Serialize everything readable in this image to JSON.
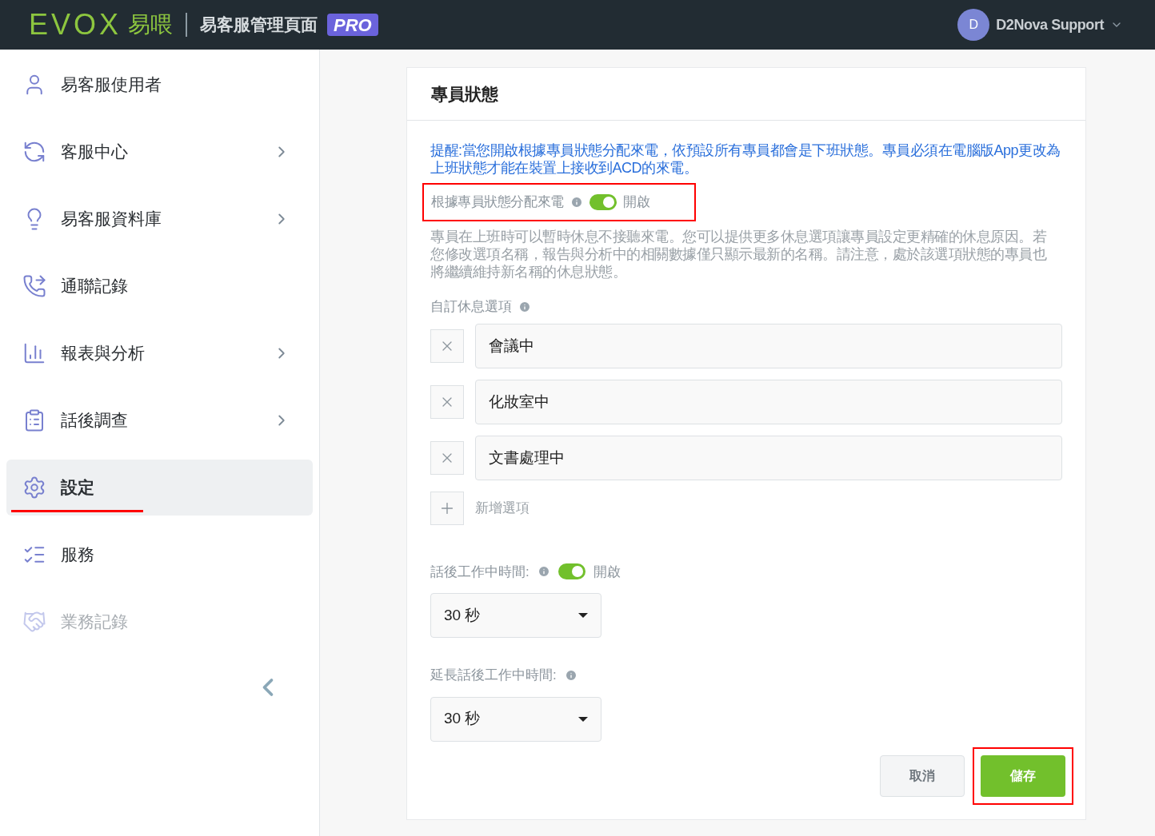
{
  "header": {
    "logo_latin": "EVOX",
    "logo_cjk": "易喂",
    "title": "易客服管理頁面",
    "badge": "PRO",
    "user": {
      "initial": "D",
      "name": "D2Nova Support"
    }
  },
  "sidebar": {
    "items": [
      {
        "label": "易客服使用者",
        "chevron": false,
        "selected": false,
        "disabled": false,
        "highlighted": false
      },
      {
        "label": "客服中心",
        "chevron": true,
        "selected": false,
        "disabled": false,
        "highlighted": false
      },
      {
        "label": "易客服資料庫",
        "chevron": true,
        "selected": false,
        "disabled": false,
        "highlighted": false
      },
      {
        "label": "通聯記錄",
        "chevron": false,
        "selected": false,
        "disabled": false,
        "highlighted": false
      },
      {
        "label": "報表與分析",
        "chevron": true,
        "selected": false,
        "disabled": false,
        "highlighted": false
      },
      {
        "label": "話後調查",
        "chevron": true,
        "selected": false,
        "disabled": false,
        "highlighted": false
      },
      {
        "label": "設定",
        "chevron": false,
        "selected": true,
        "disabled": false,
        "highlighted": true
      },
      {
        "label": "服務",
        "chevron": false,
        "selected": false,
        "disabled": false,
        "highlighted": false
      },
      {
        "label": "業務記錄",
        "chevron": false,
        "selected": false,
        "disabled": true,
        "highlighted": false
      }
    ]
  },
  "card": {
    "title": "專員狀態",
    "notice": "提醒:當您開啟根據專員狀態分配來電，依預設所有專員都會是下班狀態。專員必須在電腦版App更改為上班狀態才能在裝置上接收到ACD的來電。",
    "status_toggle": {
      "label": "根據專員狀態分配來電",
      "on": true,
      "state_text": "開啟",
      "highlighted": true
    },
    "description": "專員在上班時可以暫時休息不接聽來電。您可以提供更多休息選項讓專員設定更精確的休息原因。若您修改選項名稱，報告與分析中的相關數據僅只顯示最新的名稱。請注意，處於該選項狀態的專員也將繼續維持新名稱的休息狀態。",
    "break_options_label": "自訂休息選項",
    "break_options": [
      {
        "value": "會議中"
      },
      {
        "value": "化妝室中"
      },
      {
        "value": "文書處理中"
      }
    ],
    "add_option": "新增選項",
    "wrap_up": {
      "label": "話後工作中時間:",
      "on": true,
      "state_text": "開啟",
      "value": "30 秒"
    },
    "extended_wrap_up": {
      "label": "延長話後工作中時間:",
      "value": "30 秒"
    },
    "buttons": [
      {
        "label": "取消",
        "kind": "secondary",
        "highlighted": false
      },
      {
        "label": "儲存",
        "kind": "primary",
        "highlighted": true
      }
    ]
  }
}
